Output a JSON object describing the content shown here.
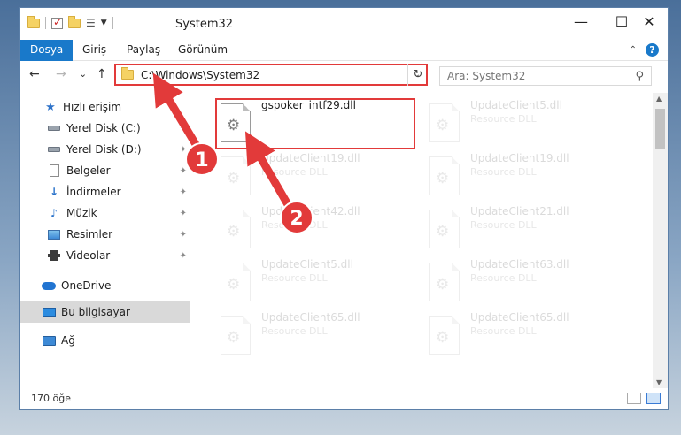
{
  "window": {
    "title": "System32",
    "controls": {
      "minimize": "—",
      "maximize": "☐",
      "close": "✕"
    }
  },
  "ribbon": {
    "tabs": [
      {
        "label": "Dosya",
        "active": true
      },
      {
        "label": "Giriş"
      },
      {
        "label": "Paylaş"
      },
      {
        "label": "Görünüm"
      }
    ],
    "collapse_icon": "chevron-up-icon",
    "help": "?"
  },
  "nav": {
    "back": "←",
    "forward": "→",
    "recent": "⌄",
    "up": "↑",
    "address": "C:\\Windows\\System32",
    "refresh": "↻",
    "search_placeholder": "Ara: System32",
    "search_icon": "⚲"
  },
  "sidebar": {
    "items": [
      {
        "label": "Hızlı erişim",
        "icon": "star-icon"
      },
      {
        "label": "Yerel Disk (C:)",
        "icon": "disk-icon",
        "pinned": true
      },
      {
        "label": "Yerel Disk (D:)",
        "icon": "disk-icon",
        "pinned": true
      },
      {
        "label": "Belgeler",
        "icon": "document-icon",
        "pinned": true
      },
      {
        "label": "İndirmeler",
        "icon": "download-icon",
        "pinned": true
      },
      {
        "label": "Müzik",
        "icon": "music-icon",
        "pinned": true
      },
      {
        "label": "Resimler",
        "icon": "picture-icon",
        "pinned": true
      },
      {
        "label": "Videolar",
        "icon": "video-icon",
        "pinned": true
      },
      {
        "label": "OneDrive",
        "icon": "cloud-icon"
      },
      {
        "label": "Bu bilgisayar",
        "icon": "computer-icon",
        "selected": true
      },
      {
        "label": "Ağ",
        "icon": "network-icon"
      }
    ],
    "pin_glyph": "📌"
  },
  "files": [
    {
      "name": "gspoker_intf29.dll",
      "type": "",
      "highlighted": true
    },
    {
      "name": "UpdateClient5.dll",
      "type": "Resource DLL"
    },
    {
      "name": "UpdateClient19.dll",
      "type": "Resource DLL"
    },
    {
      "name": "UpdateClient19.dll",
      "type": "Resource DLL"
    },
    {
      "name": "UpdateClient42.dll",
      "type": "Resource DLL"
    },
    {
      "name": "UpdateClient21.dll",
      "type": "Resource DLL"
    },
    {
      "name": "UpdateClient5.dll",
      "type": "Resource DLL"
    },
    {
      "name": "UpdateClient63.dll",
      "type": "Resource DLL"
    },
    {
      "name": "UpdateClient65.dll",
      "type": "Resource DLL"
    },
    {
      "name": "UpdateClient65.dll",
      "type": "Resource DLL"
    }
  ],
  "status": {
    "count": "170 öğe"
  },
  "annotations": {
    "step1": "1",
    "step2": "2",
    "color": "#e23a3a"
  }
}
